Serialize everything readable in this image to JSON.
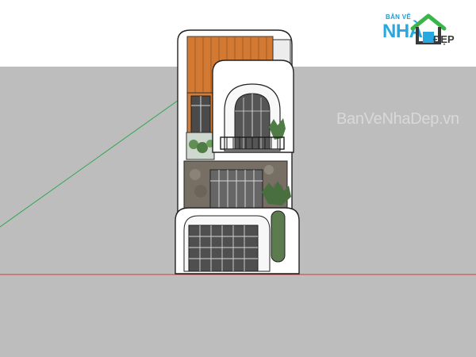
{
  "logo": {
    "small_text": "BẢN VẼ",
    "big_text": "NHÀ",
    "suffix_text": "ĐẸP"
  },
  "watermark": {
    "text": "BanVeNhaDep.vn"
  },
  "colors": {
    "sky": "#ffffff",
    "ground": "#bdbdbd",
    "wall_white": "#ffffff",
    "wood": "#d27a33",
    "stone": "#7a766f",
    "dark": "#2f2f2f",
    "green_axis": "#2fa84f",
    "red_axis": "#d33a3a",
    "logo_blue": "#27a8e0",
    "logo_green": "#39b54a",
    "watermark": "#d9d9d9"
  }
}
